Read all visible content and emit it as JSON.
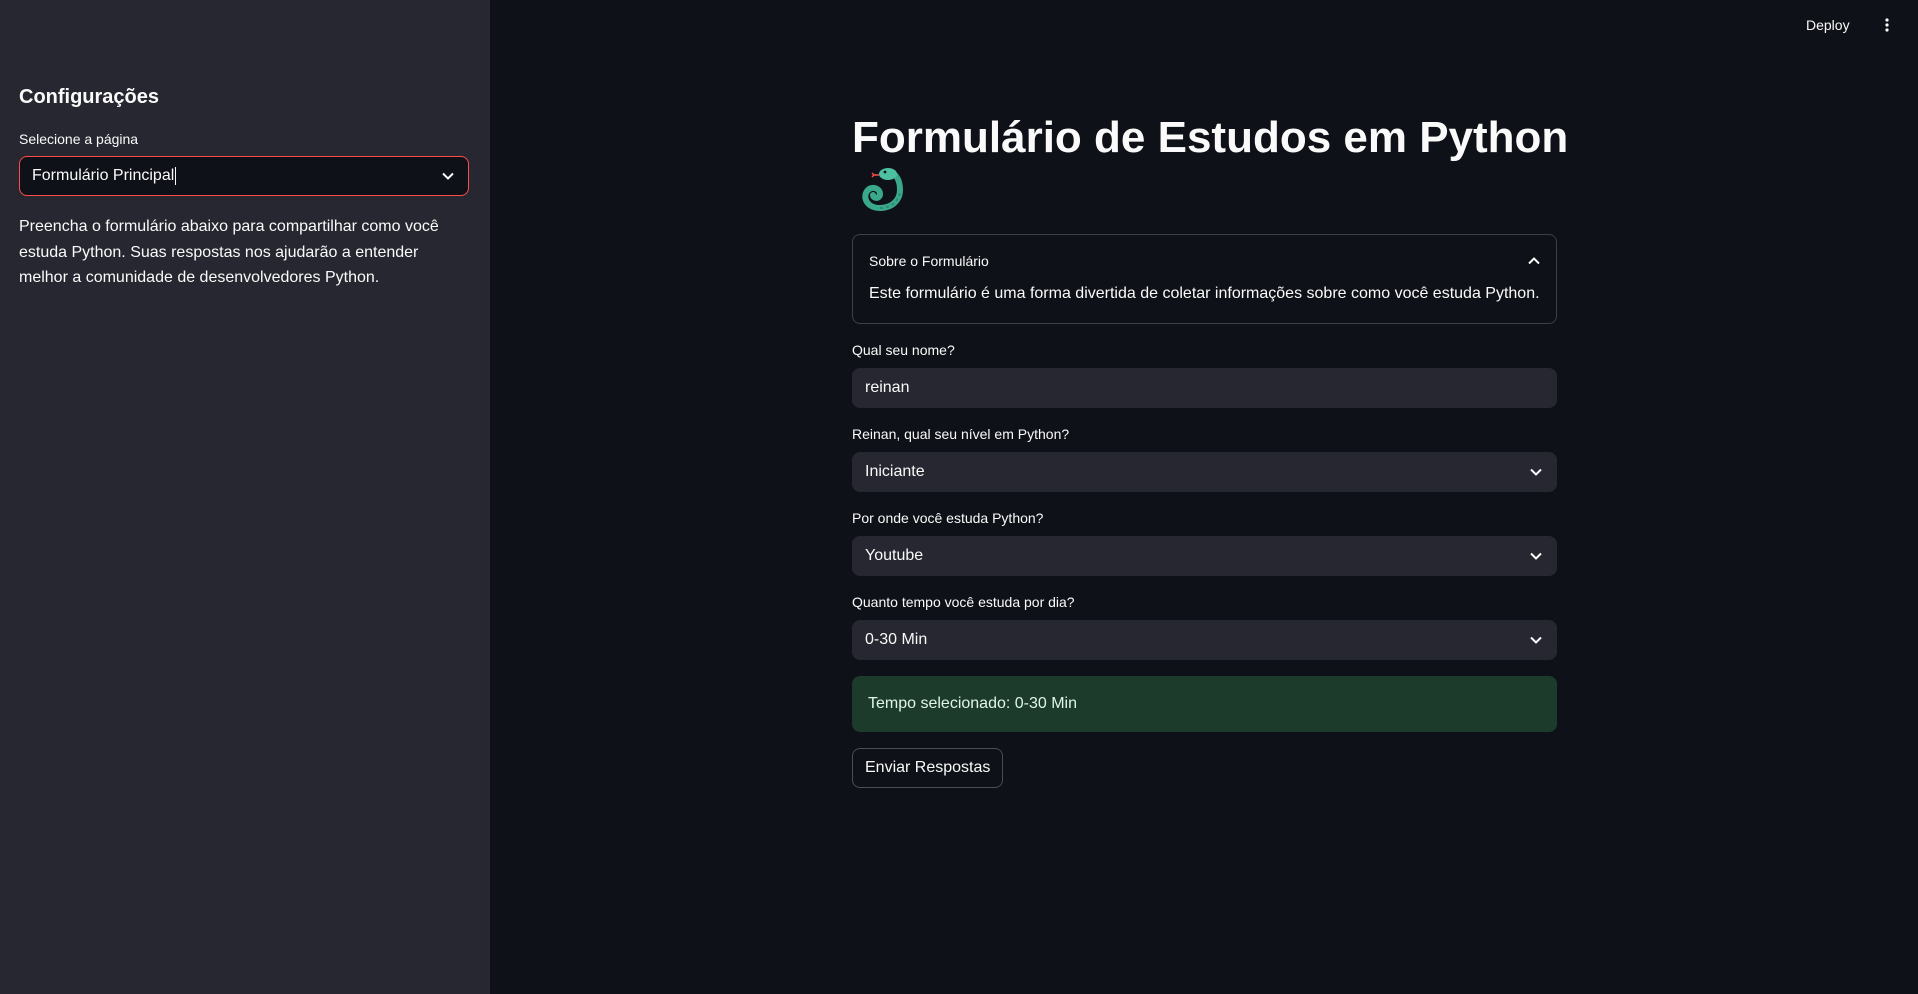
{
  "sidebar": {
    "title": "Configurações",
    "select_label": "Selecione a página",
    "select_value": "Formulário Principal",
    "description": "Preencha o formulário abaixo para compartilhar como você estuda Python. Suas respostas nos ajudarão a entender melhor a comunidade de desenvolvedores Python."
  },
  "toolbar": {
    "deploy_label": "Deploy",
    "menu_icon": "vertical-dots-icon"
  },
  "main": {
    "title": "Formulário de Estudos em Python",
    "title_icon": "snake-icon",
    "expander": {
      "label": "Sobre o Formulário",
      "body": "Este formulário é uma forma divertida de coletar informações sobre como você estuda Python."
    },
    "name_field": {
      "label": "Qual seu nome?",
      "value": "reinan"
    },
    "level_field": {
      "label": "Reinan, qual seu nível em Python?",
      "value": "Iniciante"
    },
    "source_field": {
      "label": "Por onde você estuda Python?",
      "value": "Youtube"
    },
    "time_field": {
      "label": "Quanto tempo você estuda por dia?",
      "value": "0-30 Min"
    },
    "success_message": "Tempo selecionado: 0-30 Min",
    "submit_label": "Enviar Respostas"
  },
  "colors": {
    "background": "#0e1117",
    "sidebar": "#262730",
    "accent": "#ff4b4b",
    "success_bg": "#1c3b2a"
  }
}
